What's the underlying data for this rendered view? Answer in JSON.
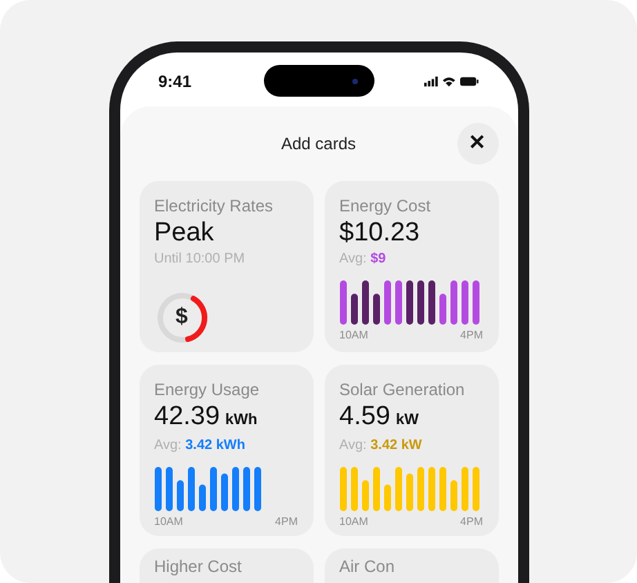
{
  "status_bar": {
    "time": "9:41"
  },
  "sheet": {
    "title": "Add cards",
    "close": "✕"
  },
  "cards": [
    {
      "kind": "rate",
      "title": "Electricity Rates",
      "value": "Peak",
      "subtitle": "Until 10:00 PM",
      "icon": "$"
    },
    {
      "kind": "chart",
      "title": "Energy Cost",
      "value": "$10.23",
      "avg_label": "Avg:",
      "avg": "$9",
      "color": "#b44be1",
      "start": "10AM",
      "end": "4PM"
    },
    {
      "kind": "chart",
      "title": "Energy Usage",
      "value": "42.39",
      "unit": "kWh",
      "avg_label": "Avg:",
      "avg": "3.42 kWh",
      "color": "#147efb",
      "start": "10AM",
      "end": "4PM"
    },
    {
      "kind": "chart",
      "title": "Solar Generation",
      "value": "4.59",
      "unit": "kW",
      "avg_label": "Avg:",
      "avg": "3.42 kW",
      "color": "#c99a0c",
      "start": "10AM",
      "end": "4PM"
    },
    {
      "kind": "partial",
      "title": "Higher Cost"
    },
    {
      "kind": "partial",
      "title": "Air Con"
    }
  ]
}
